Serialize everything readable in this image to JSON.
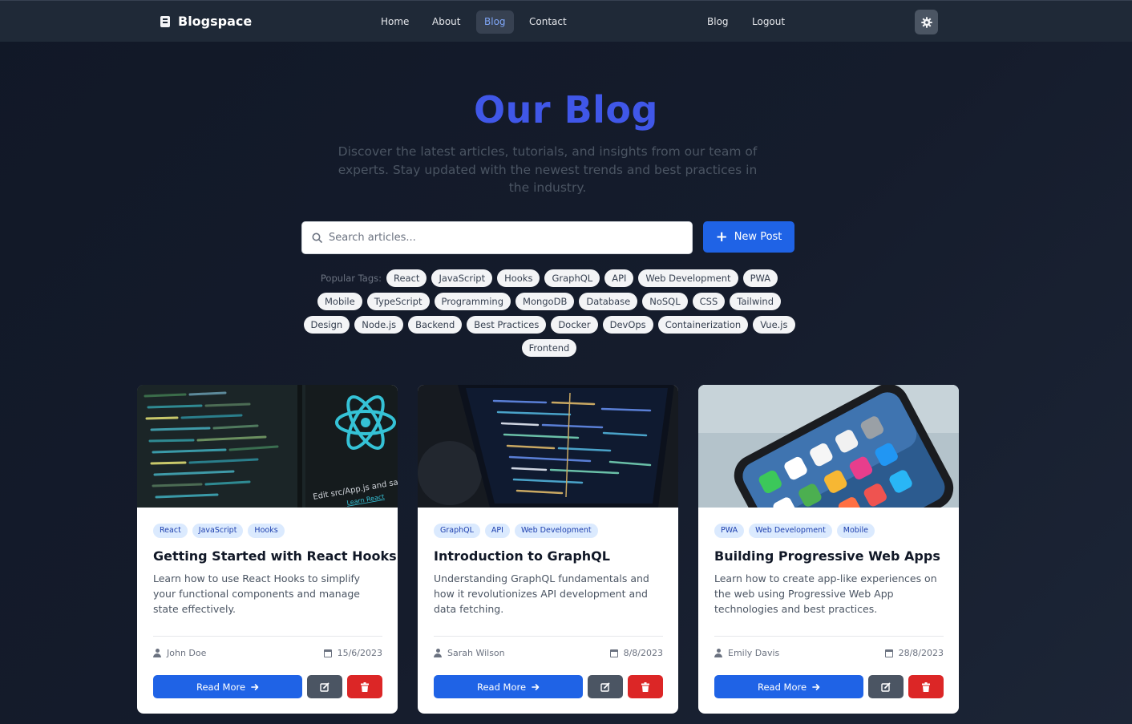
{
  "nav": {
    "brand": "Blogspace",
    "links": [
      {
        "label": "Home"
      },
      {
        "label": "About"
      },
      {
        "label": "Blog",
        "active": true
      },
      {
        "label": "Contact"
      }
    ],
    "right_links": [
      {
        "label": "Blog"
      },
      {
        "label": "Logout"
      }
    ],
    "theme_icon": "gear-icon"
  },
  "hero": {
    "title": "Our Blog",
    "subtitle": "Discover the latest articles, tutorials, and insights from our team of experts. Stay updated with the newest trends and best practices in the industry."
  },
  "search": {
    "placeholder": "Search articles...",
    "value": ""
  },
  "new_post_label": "New Post",
  "tags": {
    "label": "Popular Tags:",
    "items": [
      "React",
      "JavaScript",
      "Hooks",
      "GraphQL",
      "API",
      "Web Development",
      "PWA",
      "Mobile",
      "TypeScript",
      "Programming",
      "MongoDB",
      "Database",
      "NoSQL",
      "CSS",
      "Tailwind",
      "Design",
      "Node.js",
      "Backend",
      "Best Practices",
      "Docker",
      "DevOps",
      "Containerization",
      "Vue.js",
      "Frontend"
    ]
  },
  "posts": [
    {
      "tags": [
        "React",
        "JavaScript",
        "Hooks"
      ],
      "title": "Getting Started with React Hooks",
      "description": "Learn how to use React Hooks to simplify your functional components and manage state effectively.",
      "author": "John Doe",
      "date": "15/6/2023",
      "image_text": "Edit src/App.js and save to reload.",
      "image_link": "Learn React"
    },
    {
      "tags": [
        "GraphQL",
        "API",
        "Web Development"
      ],
      "title": "Introduction to GraphQL",
      "description": "Understanding GraphQL fundamentals and how it revolutionizes API development and data fetching.",
      "author": "Sarah Wilson",
      "date": "8/8/2023"
    },
    {
      "tags": [
        "PWA",
        "Web Development",
        "Mobile"
      ],
      "title": "Building Progressive Web Apps",
      "description": "Learn how to create app-like experiences on the web using Progressive Web App technologies and best practices.",
      "author": "Emily Davis",
      "date": "28/8/2023"
    }
  ],
  "read_more_label": "Read More",
  "colors": {
    "accent": "#1f63e6",
    "title": "#4057e8",
    "danger": "#dc2626",
    "secondary": "#4b5563",
    "navbar": "#1f2937"
  }
}
